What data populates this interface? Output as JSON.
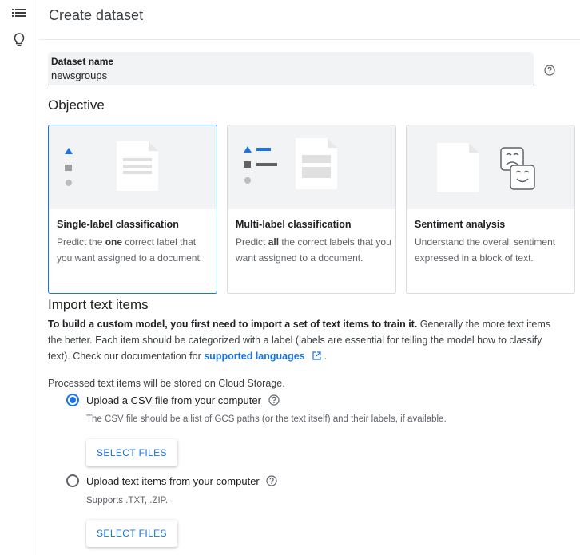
{
  "rail": {
    "icons": [
      "list-icon",
      "lightbulb-icon"
    ]
  },
  "header": {
    "title": "Create dataset"
  },
  "dataset_name": {
    "label": "Dataset name",
    "value": "newsgroups"
  },
  "objective": {
    "heading": "Objective",
    "cards": [
      {
        "title": "Single-label classification",
        "desc_pre": "Predict the ",
        "desc_bold": "one",
        "desc_post": " correct label that you want assigned to a document.",
        "selected": true
      },
      {
        "title": "Multi-label classification",
        "desc_pre": "Predict ",
        "desc_bold": "all",
        "desc_post": " the correct labels that you want assigned to a document.",
        "selected": false
      },
      {
        "title": "Sentiment analysis",
        "desc_pre": "Understand the overall sentiment expressed in a block of text.",
        "desc_bold": "",
        "desc_post": "",
        "selected": false
      }
    ]
  },
  "import": {
    "heading": "Import text items",
    "intro_bold": "To build a custom model, you first need to import a set of text items to train it.",
    "intro_rest": " Generally the more text items the better. Each item should be categorized with a label (labels are essential for telling the model how to classify text). Check our documentation for ",
    "link": "supported languages",
    "intro_end": " .",
    "stored": "Processed text items will be stored on Cloud Storage.",
    "options": [
      {
        "label": "Upload a CSV file from your computer",
        "sub": "The CSV file should be a list of GCS paths (or the text itself) and their labels, if available.",
        "button": "SELECT FILES",
        "checked": true
      },
      {
        "label": "Upload text items from your computer",
        "sub": "Supports .TXT, .ZIP.",
        "button": "SELECT FILES",
        "checked": false
      }
    ]
  },
  "colors": {
    "accent": "#1a73e8",
    "card_art_bg": "#f1f3f4",
    "border": "#dadce0"
  }
}
